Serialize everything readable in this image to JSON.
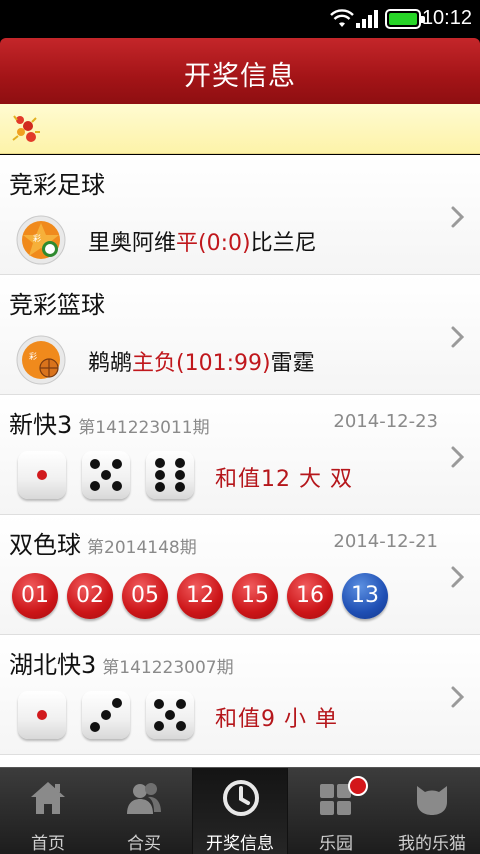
{
  "statusbar": {
    "time": "10:12",
    "battery_color": "#27d427"
  },
  "header": {
    "title": "开奖信息"
  },
  "colors": {
    "accent": "#a31417",
    "highlight_red": "#c0171c",
    "blue_ball": "#1f4fb4"
  },
  "items": [
    {
      "title": "竞彩足球",
      "logo_icon": "football-lottery-icon",
      "home": "里奥阿维",
      "result": "平(0:0)",
      "away": "比兰尼"
    },
    {
      "title": "竞彩篮球",
      "logo_icon": "basketball-lottery-icon",
      "home": "鹈鹕",
      "result": "主负(101:99)",
      "away": "雷霆"
    },
    {
      "title": "新快3",
      "issue": "第141223011期",
      "date": "2014-12-23",
      "dice": [
        1,
        5,
        6
      ],
      "sum_text": "和值12 大 双"
    },
    {
      "title": "双色球",
      "issue": "第2014148期",
      "date": "2014-12-21",
      "red_balls": [
        "01",
        "02",
        "05",
        "12",
        "15",
        "16"
      ],
      "blue_ball": "13"
    },
    {
      "title": "湖北快3",
      "issue": "第141223007期",
      "dice": [
        1,
        3,
        5
      ],
      "sum_text": "和值9 小 单"
    }
  ],
  "tabs": [
    {
      "label": "首页",
      "icon": "home-icon",
      "active": false
    },
    {
      "label": "合买",
      "icon": "group-buy-icon",
      "active": false
    },
    {
      "label": "开奖信息",
      "icon": "clock-icon",
      "active": true
    },
    {
      "label": "乐园",
      "icon": "apps-grid-icon",
      "active": false,
      "badge": true
    },
    {
      "label": "我的乐猫",
      "icon": "cat-icon",
      "active": false
    }
  ]
}
